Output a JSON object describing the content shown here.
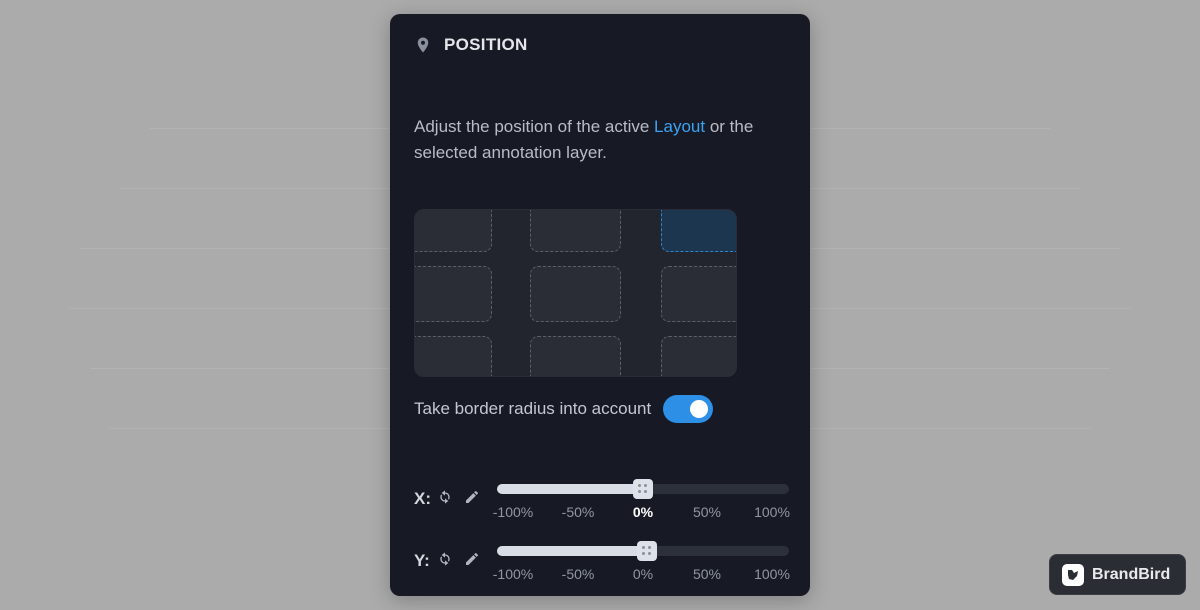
{
  "panel": {
    "title": "POSITION",
    "title_icon": "pin-icon",
    "description_before": "Adjust the position of the active ",
    "description_link": "Layout",
    "description_after": " or the selected annotation layer.",
    "active_position": "top-right"
  },
  "toggle": {
    "label": "Take border radius into account",
    "on": true
  },
  "sliders": [
    {
      "axis": "X:",
      "value": "0%",
      "ticks": [
        "-100%",
        "-50%",
        "0%",
        "50%",
        "100%"
      ],
      "current_tick": "0%"
    },
    {
      "axis": "Y:",
      "value": "0%",
      "ticks": [
        "-100%",
        "-50%",
        "0%",
        "50%",
        "100%"
      ]
    }
  ],
  "brand": {
    "name": "BrandBird"
  },
  "colors": {
    "accent": "#2d8fe6",
    "link": "#3ba2f2",
    "panel_bg": "#171a24",
    "page_bg": "#ababab"
  }
}
